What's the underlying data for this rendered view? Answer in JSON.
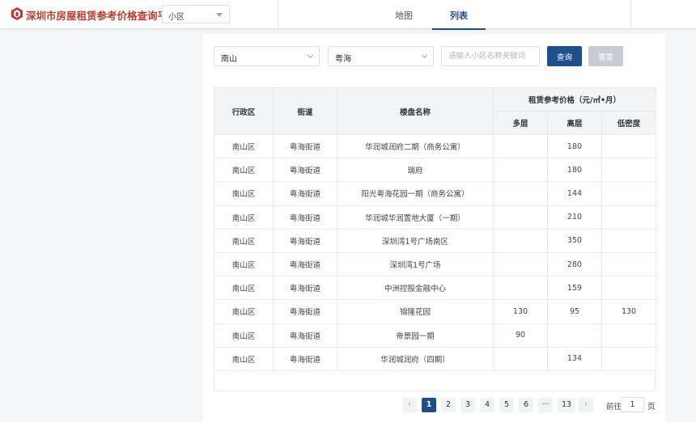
{
  "header": {
    "app_title": "深圳市房屋租赁参考价格查询平台",
    "logo_icon": "building-cube-icon",
    "type_select": "小区",
    "tabs": [
      {
        "label": "地图",
        "active": false
      },
      {
        "label": "列表",
        "active": true
      }
    ]
  },
  "filters": {
    "district": "南山",
    "street": "粤海",
    "keyword_placeholder": "请输入小区名称关键词",
    "keyword_value": "",
    "query_label": "查询",
    "reset_label": "重置"
  },
  "table": {
    "columns": {
      "district": "行政区",
      "street": "街道",
      "estate": "楼盘名称",
      "price_group": "租赁参考价格（元/㎡•月）",
      "multi": "多层",
      "high": "高层",
      "low_density": "低密度"
    },
    "rows": [
      {
        "district": "南山区",
        "street": "粤海街道",
        "estate": "华润城润府二期（商务公寓）",
        "multi": "",
        "high": "180",
        "low": ""
      },
      {
        "district": "南山区",
        "street": "粤海街道",
        "estate": "瑞府",
        "multi": "",
        "high": "180",
        "low": ""
      },
      {
        "district": "南山区",
        "street": "粤海街道",
        "estate": "阳光粤海花园一期（商务公寓）",
        "multi": "",
        "high": "144",
        "low": ""
      },
      {
        "district": "南山区",
        "street": "粤海街道",
        "estate": "华润城华润置地大厦（一期）",
        "multi": "",
        "high": "210",
        "low": ""
      },
      {
        "district": "南山区",
        "street": "粤海街道",
        "estate": "深圳湾1号广场南区",
        "multi": "",
        "high": "350",
        "low": ""
      },
      {
        "district": "南山区",
        "street": "粤海街道",
        "estate": "深圳湾1号广场",
        "multi": "",
        "high": "280",
        "low": ""
      },
      {
        "district": "南山区",
        "street": "粤海街道",
        "estate": "中洲控股金融中心",
        "multi": "",
        "high": "159",
        "low": ""
      },
      {
        "district": "南山区",
        "street": "粤海街道",
        "estate": "锦隆花园",
        "multi": "130",
        "high": "95",
        "low": "130"
      },
      {
        "district": "南山区",
        "street": "粤海街道",
        "estate": "帝景园一期",
        "multi": "90",
        "high": "",
        "low": ""
      },
      {
        "district": "南山区",
        "street": "粤海街道",
        "estate": "华润城润府（四期）",
        "multi": "",
        "high": "134",
        "low": ""
      }
    ]
  },
  "pagination": {
    "prev": "‹",
    "next": "›",
    "pages": [
      "1",
      "2",
      "3",
      "4",
      "5",
      "6"
    ],
    "ellipsis": "···",
    "last": "13",
    "current": "1",
    "goto_label": "前往",
    "goto_value": "1",
    "goto_suffix": "页"
  },
  "colors": {
    "brand": "#c0392b",
    "primary": "#1d4f8c",
    "disabled": "#c7ccd3"
  }
}
